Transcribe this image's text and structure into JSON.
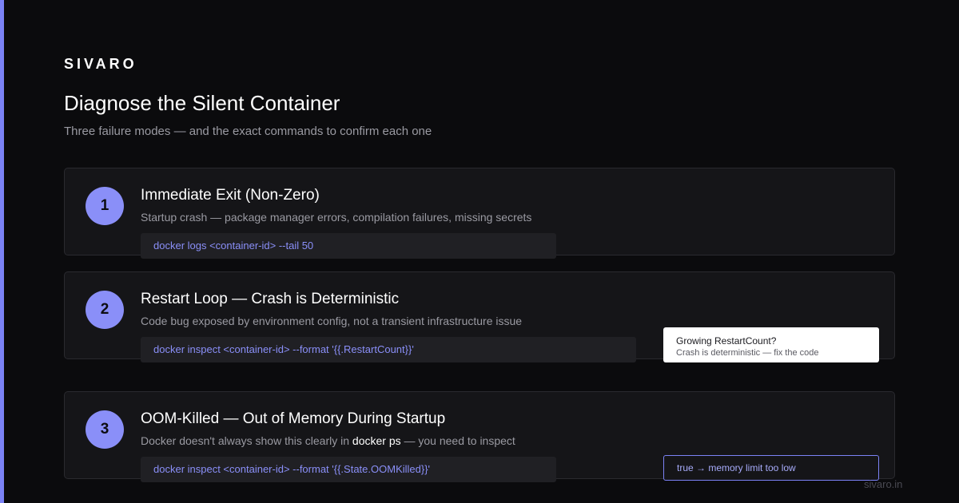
{
  "brand": "SIVARO",
  "title": "Diagnose the Silent Container",
  "subtitle": "Three failure modes — and the exact commands to confirm each one",
  "colors": {
    "accent": "#7b82f5",
    "badge_number_bg": "#8a8ff8",
    "card_bg": "#151518",
    "command_text": "#8a8ff8"
  },
  "cards": [
    {
      "number": "1",
      "title": "Immediate Exit (Non-Zero)",
      "description": "Startup crash — package manager errors, compilation failures, missing secrets",
      "command": "docker logs <container-id> --tail 50"
    },
    {
      "number": "2",
      "title": "Restart Loop — Crash is Deterministic",
      "description": "Code bug exposed by environment config, not a transient infrastructure issue",
      "command": "docker inspect <container-id> --format '{{.RestartCount}}'",
      "callout": {
        "title": "Growing RestartCount?",
        "subtitle": "Crash is deterministic — fix the code"
      }
    },
    {
      "number": "3",
      "title": "OOM-Killed — Out of Memory During Startup",
      "description_parts": [
        "Docker doesn't always show this clearly in ",
        "docker ps",
        " — you need to inspect"
      ],
      "command": "docker inspect <container-id> --format '{{.State.OOMKilled}}'",
      "result": "true → memory limit too low"
    }
  ],
  "footer": "sivaro.in"
}
